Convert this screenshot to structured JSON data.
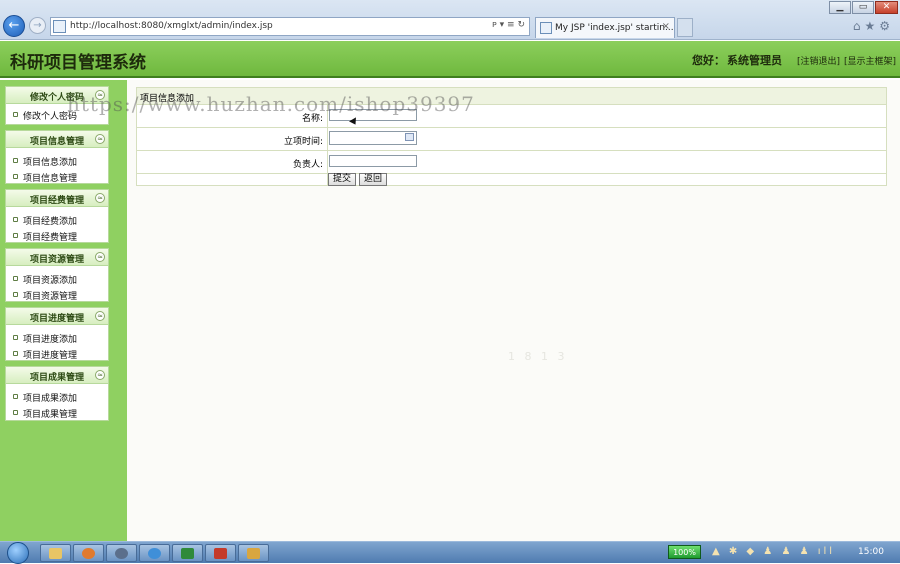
{
  "browser": {
    "url": "http://localhost:8080/xmglxt/admin/index.jsp",
    "tab_title": "My JSP 'index.jsp' startin...",
    "address_controls": "ᴘ ▾ ≡ ↻",
    "tab_close": "×",
    "window_min": "▁",
    "window_max": "▭",
    "window_close": "✕",
    "toolbar_icons": "⌂★⚙"
  },
  "app": {
    "title": "科研项目管理系统",
    "greeting": "您好：",
    "user": "系统管理员",
    "logout_label": "[注销退出]",
    "home_label": "[显示主框架]"
  },
  "sidebar": {
    "collapse_glyph": "≈",
    "groups": [
      {
        "title": "修改个人密码",
        "items": [
          "修改个人密码"
        ]
      },
      {
        "title": "项目信息管理",
        "items": [
          "项目信息添加",
          "项目信息管理"
        ]
      },
      {
        "title": "项目经费管理",
        "items": [
          "项目经费添加",
          "项目经费管理"
        ]
      },
      {
        "title": "项目资源管理",
        "items": [
          "项目资源添加",
          "项目资源管理"
        ]
      },
      {
        "title": "项目进度管理",
        "items": [
          "项目进度添加",
          "项目进度管理"
        ]
      },
      {
        "title": "项目成果管理",
        "items": [
          "项目成果添加",
          "项目成果管理"
        ]
      }
    ]
  },
  "form": {
    "title": "项目信息添加",
    "fields": [
      {
        "label": "名称:",
        "value": ""
      },
      {
        "label": "立项时间:",
        "value": ""
      },
      {
        "label": "负责人:",
        "value": ""
      }
    ],
    "submit_label": "提交",
    "back_label": "返回"
  },
  "overlay": {
    "watermark": "https://www.huzhan.com/ishop39397",
    "faint_text": "1 8 1 3"
  },
  "taskbar": {
    "battery": "100%",
    "tray": "▲ ✱ ◆ ♟ ♟ ♟ ıll",
    "clock": "15:00"
  },
  "colors": {
    "header_green": "#7cc24a",
    "sidebar_green": "#8fd061",
    "taskbar_blue": "#5b86bb"
  }
}
